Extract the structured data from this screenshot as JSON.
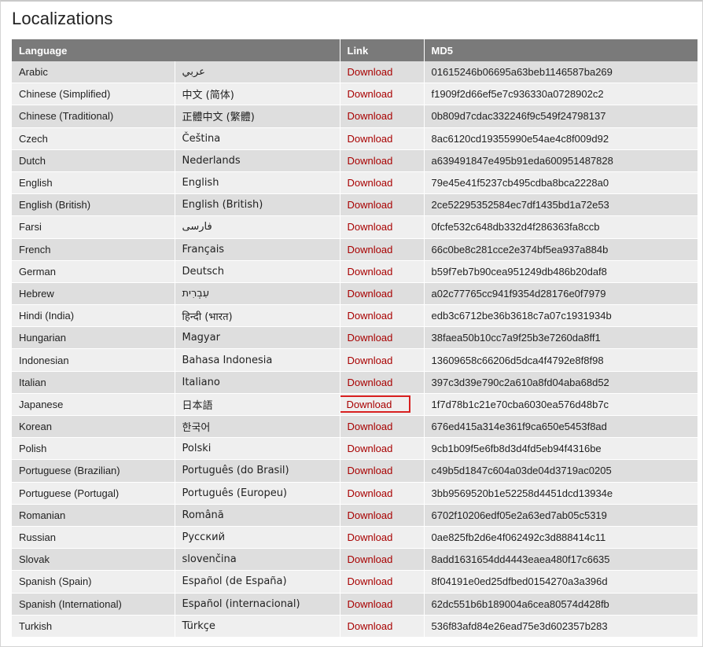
{
  "page": {
    "title": "Localizations"
  },
  "table": {
    "headers": {
      "language": "Language",
      "link": "Link",
      "md5": "MD5"
    },
    "download_label": "Download",
    "focused_row": 15,
    "rows": [
      {
        "language": "Arabic",
        "native": "عربي",
        "md5": "01615246b06695a63beb1146587ba269"
      },
      {
        "language": "Chinese (Simplified)",
        "native": "中文 (简体)",
        "md5": "f1909f2d66ef5e7c936330a0728902c2"
      },
      {
        "language": "Chinese (Traditional)",
        "native": "正體中文 (繁體)",
        "md5": "0b809d7cdac332246f9c549f24798137"
      },
      {
        "language": "Czech",
        "native": "Čeština",
        "md5": "8ac6120cd19355990e54ae4c8f009d92"
      },
      {
        "language": "Dutch",
        "native": "Nederlands",
        "md5": "a639491847e495b91eda600951487828"
      },
      {
        "language": "English",
        "native": "English",
        "md5": "79e45e41f5237cb495cdba8bca2228a0"
      },
      {
        "language": "English (British)",
        "native": "English (British)",
        "md5": "2ce52295352584ec7df1435bd1a72e53"
      },
      {
        "language": "Farsi",
        "native": "فارسی",
        "md5": "0fcfe532c648db332d4f286363fa8ccb"
      },
      {
        "language": "French",
        "native": "Français",
        "md5": "66c0be8c281cce2e374bf5ea937a884b"
      },
      {
        "language": "German",
        "native": "Deutsch",
        "md5": "b59f7eb7b90cea951249db486b20daf8"
      },
      {
        "language": "Hebrew",
        "native": "עִבְרִית",
        "md5": "a02c77765cc941f9354d28176e0f7979"
      },
      {
        "language": "Hindi (India)",
        "native": "हिन्दी (भारत)",
        "md5": "edb3c6712be36b3618c7a07c1931934b"
      },
      {
        "language": "Hungarian",
        "native": "Magyar",
        "md5": "38faea50b10cc7a9f25b3e7260da8ff1"
      },
      {
        "language": "Indonesian",
        "native": "Bahasa Indonesia",
        "md5": "13609658c66206d5dca4f4792e8f8f98"
      },
      {
        "language": "Italian",
        "native": "Italiano",
        "md5": "397c3d39e790c2a610a8fd04aba68d52"
      },
      {
        "language": "Japanese",
        "native": "日本語",
        "md5": "1f7d78b1c21e70cba6030ea576d48b7c"
      },
      {
        "language": "Korean",
        "native": "한국어",
        "md5": "676ed415a314e361f9ca650e5453f8ad"
      },
      {
        "language": "Polish",
        "native": "Polski",
        "md5": "9cb1b09f5e6fb8d3d4fd5eb94f4316be"
      },
      {
        "language": "Portuguese (Brazilian)",
        "native": "Português (do Brasil)",
        "md5": "c49b5d1847c604a03de04d3719ac0205"
      },
      {
        "language": "Portuguese (Portugal)",
        "native": "Português (Europeu)",
        "md5": "3bb9569520b1e52258d4451dcd13934e"
      },
      {
        "language": "Romanian",
        "native": "Română",
        "md5": "6702f10206edf05e2a63ed7ab05c5319"
      },
      {
        "language": "Russian",
        "native": "Русский",
        "md5": "0ae825fb2d6e4f062492c3d888414c11"
      },
      {
        "language": "Slovak",
        "native": "slovenčina",
        "md5": "8add1631654dd4443eaea480f17c6635"
      },
      {
        "language": "Spanish (Spain)",
        "native": "Español (de España)",
        "md5": "8f04191e0ed25dfbed0154270a3a396d"
      },
      {
        "language": "Spanish (International)",
        "native": "Español (internacional)",
        "md5": "62dc551b6b189004a6cea80574d428fb"
      },
      {
        "language": "Turkish",
        "native": "Türkçe",
        "md5": "536f83afd84e26ead75e3d602357b283"
      }
    ]
  },
  "colors": {
    "header_bg": "#7a7a7a",
    "row_odd": "#dedede",
    "row_even": "#efefef",
    "link": "#a80000",
    "focus_outline": "#d82020"
  }
}
